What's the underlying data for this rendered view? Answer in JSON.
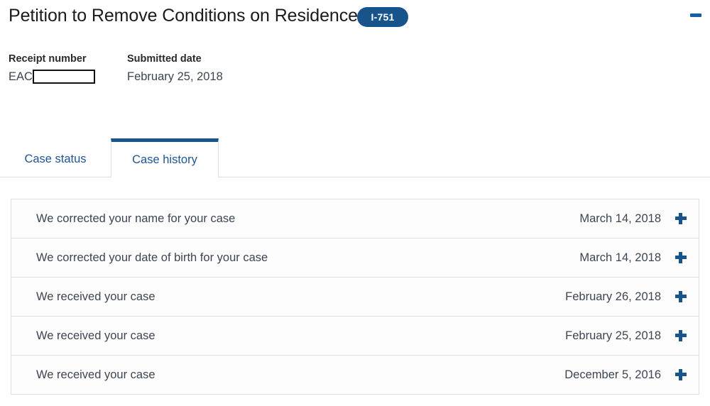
{
  "header": {
    "title": "Petition to Remove Conditions on Residence",
    "form_badge": "I-751",
    "collapse_icon": "minus-icon",
    "badge_color": "#17548c"
  },
  "meta": {
    "receipt": {
      "label": "Receipt number",
      "prefix": "EAC",
      "redacted": true
    },
    "submitted": {
      "label": "Submitted date",
      "value": "February 25, 2018"
    }
  },
  "tabs": [
    {
      "label": "Case status",
      "active": false
    },
    {
      "label": "Case history",
      "active": true
    }
  ],
  "history": {
    "expand_icon": "plus-icon",
    "rows": [
      {
        "text": "We corrected your name for your case",
        "date": "March 14, 2018"
      },
      {
        "text": "We corrected your date of birth for your case",
        "date": "March 14, 2018"
      },
      {
        "text": "We received your case",
        "date": "February 26, 2018"
      },
      {
        "text": "We received your case",
        "date": "February 25, 2018"
      },
      {
        "text": "We received your case",
        "date": "December 5, 2016"
      }
    ]
  },
  "colors": {
    "accent_blue": "#17548c",
    "link_blue": "#205493",
    "border_gray": "#dcdee0",
    "text_gray": "#3d4551"
  }
}
